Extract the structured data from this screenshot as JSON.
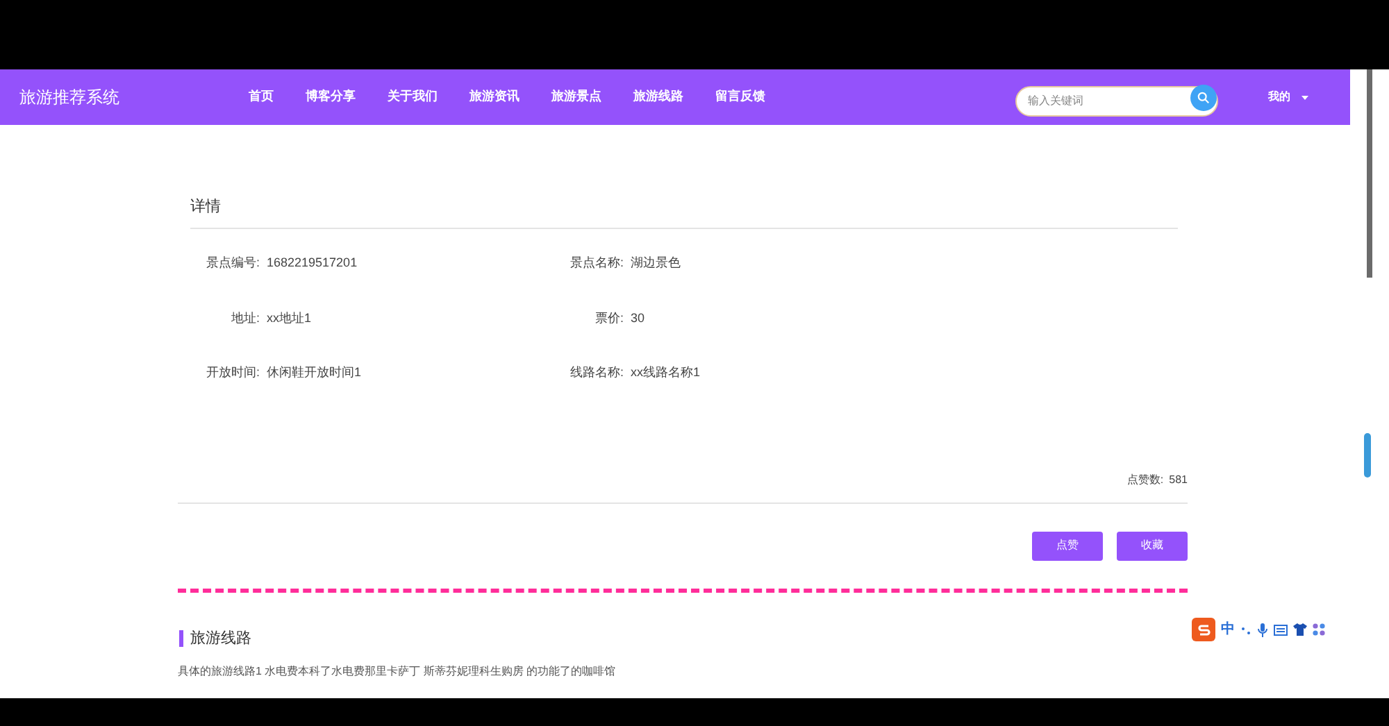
{
  "site": {
    "title": "旅游推荐系统"
  },
  "nav": [
    {
      "label": "首页"
    },
    {
      "label": "博客分享"
    },
    {
      "label": "关于我们"
    },
    {
      "label": "旅游资讯"
    },
    {
      "label": "旅游景点"
    },
    {
      "label": "旅游线路"
    },
    {
      "label": "留言反馈"
    }
  ],
  "search": {
    "placeholder": "输入关键词"
  },
  "user_menu": {
    "label": "我的"
  },
  "detail": {
    "title": "详情",
    "fields": [
      {
        "label": "景点编号:",
        "value": "1682219517201"
      },
      {
        "label": "景点名称:",
        "value": "湖边景色"
      },
      {
        "label": "地址:",
        "value": "xx地址1"
      },
      {
        "label": "票价:",
        "value": "30"
      },
      {
        "label": "开放时间:",
        "value": "休闲鞋开放时间1"
      },
      {
        "label": "线路名称:",
        "value": "xx线路名称1"
      }
    ],
    "likes": {
      "label": "点赞数:",
      "value": "581"
    },
    "buttons": [
      "点赞",
      "收藏"
    ]
  },
  "route": {
    "title": "旅游线路",
    "text": "具体的旅游线路1 水电费本科了水电费那里卡萨丁 斯蒂芬妮理科生购房 的功能了的咖啡馆"
  },
  "ime_toolbar": {
    "mode": "中"
  }
}
